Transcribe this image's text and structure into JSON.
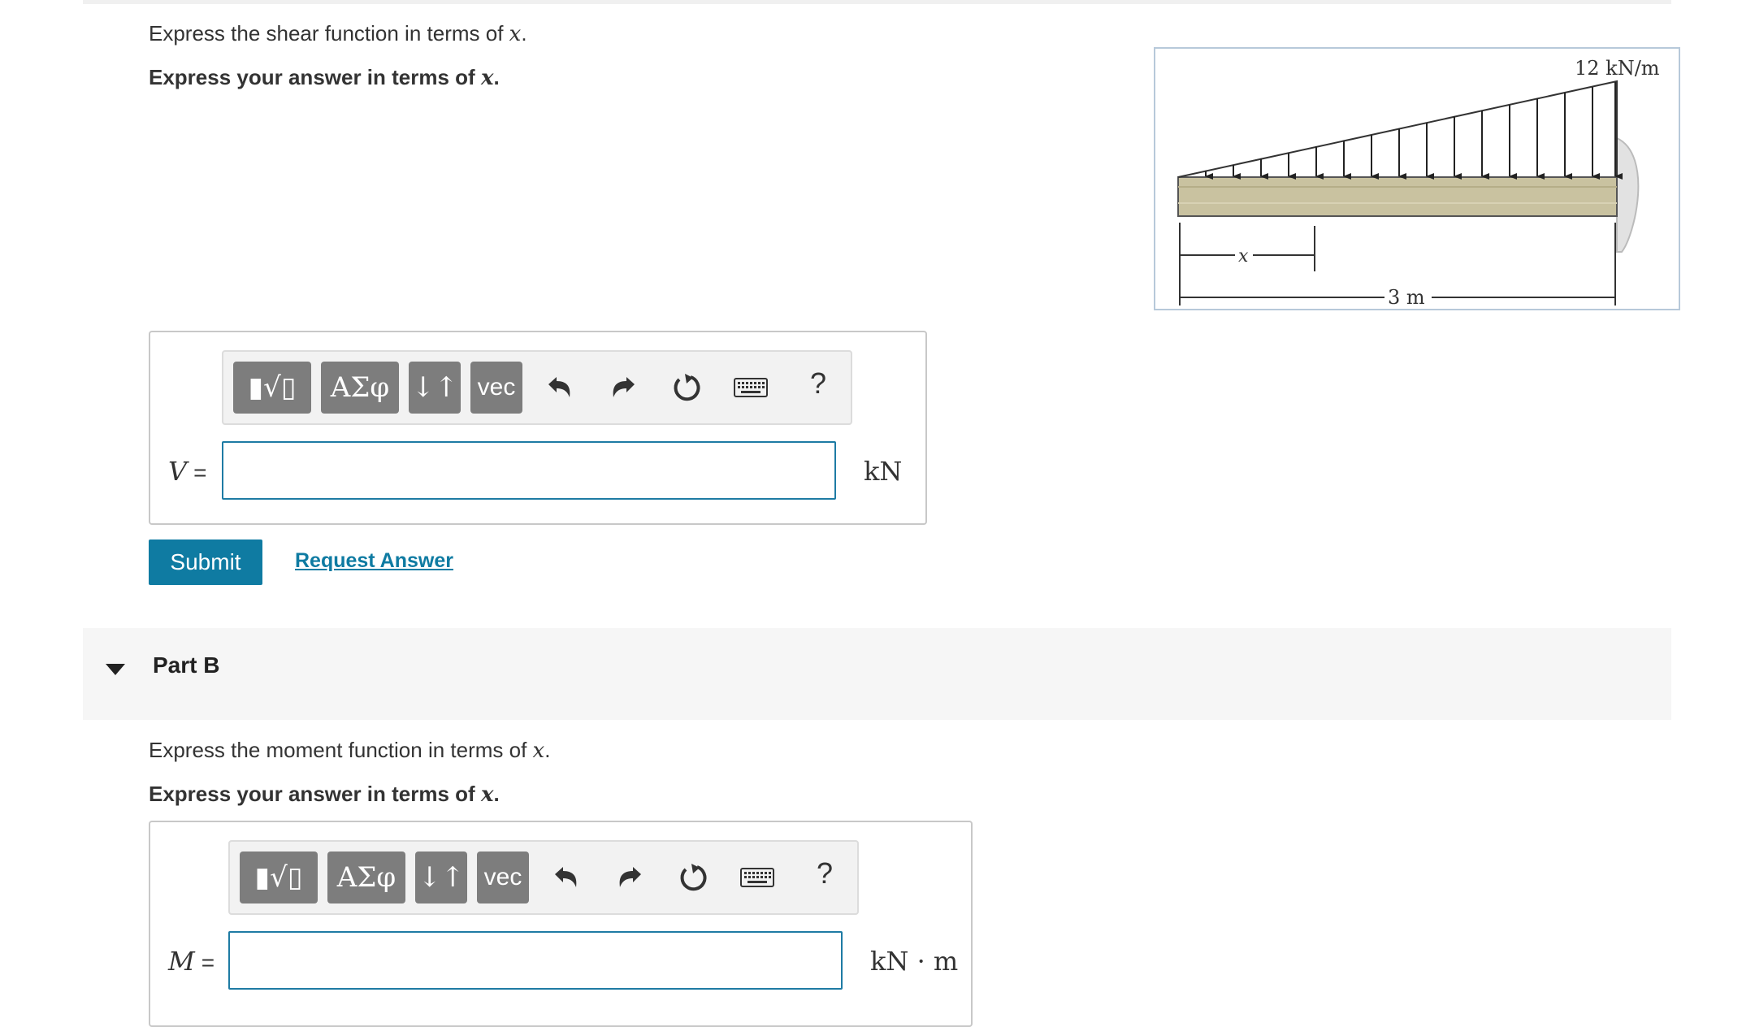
{
  "part_a": {
    "question": "Express the shear function in terms of",
    "question_var": "x",
    "instruction": "Express your answer in terms of",
    "instruction_var": "x",
    "variable": "V",
    "equals": "=",
    "input_value": "",
    "unit": "kN"
  },
  "toolbar": {
    "templates_label": "▮√▯",
    "greek_label": "ΑΣφ",
    "arrows_label": "↓↑",
    "vec_label": "vec",
    "help_label": "?"
  },
  "actions": {
    "submit_label": "Submit",
    "request_label": "Request Answer"
  },
  "part_b": {
    "title": "Part B",
    "question": "Express the moment function in terms of",
    "question_var": "x",
    "instruction": "Express your answer in terms of",
    "instruction_var": "x",
    "variable": "M",
    "equals": "=",
    "input_value": "",
    "unit": "kN · m"
  },
  "figure": {
    "load_label": "12 kN/m",
    "x_label": "x",
    "length_label": "3 m"
  },
  "colors": {
    "accent": "#0f7ba2",
    "toolbar_button": "#7d7d7d",
    "beam": "#c9c2a0"
  }
}
